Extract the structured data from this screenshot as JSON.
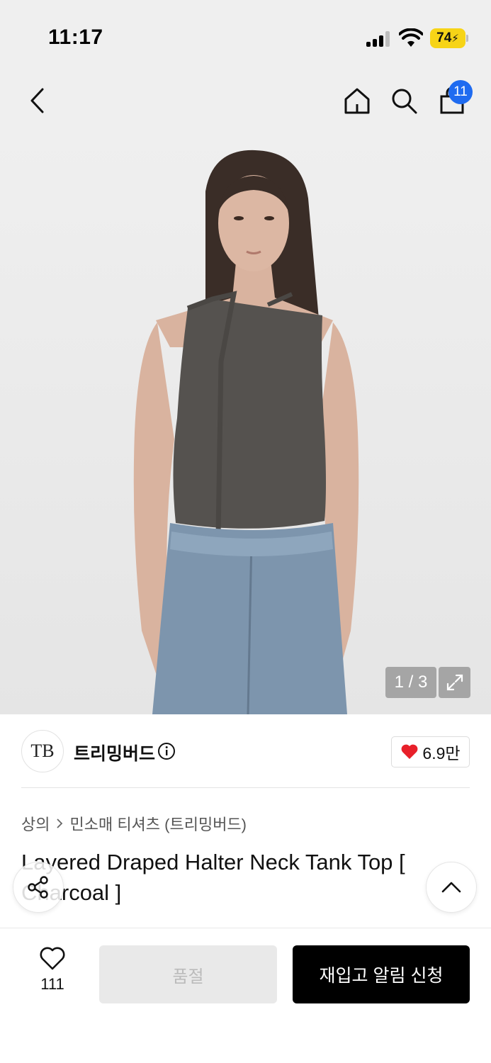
{
  "status_bar": {
    "time": "11:17",
    "battery": "74"
  },
  "nav": {
    "cart_badge": "11"
  },
  "gallery": {
    "counter": "1 / 3"
  },
  "brand": {
    "logo_text": "TB",
    "name": "트리밍버드",
    "likes": "6.9만"
  },
  "breadcrumb": {
    "category": "상의",
    "subcategory": "민소매 티셔츠 (트리밍버드)"
  },
  "product": {
    "title": "Layered Draped Halter Neck Tank Top [ Charcoal ]"
  },
  "bottom_bar": {
    "wish_count": "111",
    "soldout_label": "품절",
    "restock_label": "재입고 알림 신청"
  },
  "colors": {
    "accent_badge": "#1f6bf0",
    "heart": "#e8202a",
    "battery": "#f7d417",
    "primary_button": "#000000"
  }
}
